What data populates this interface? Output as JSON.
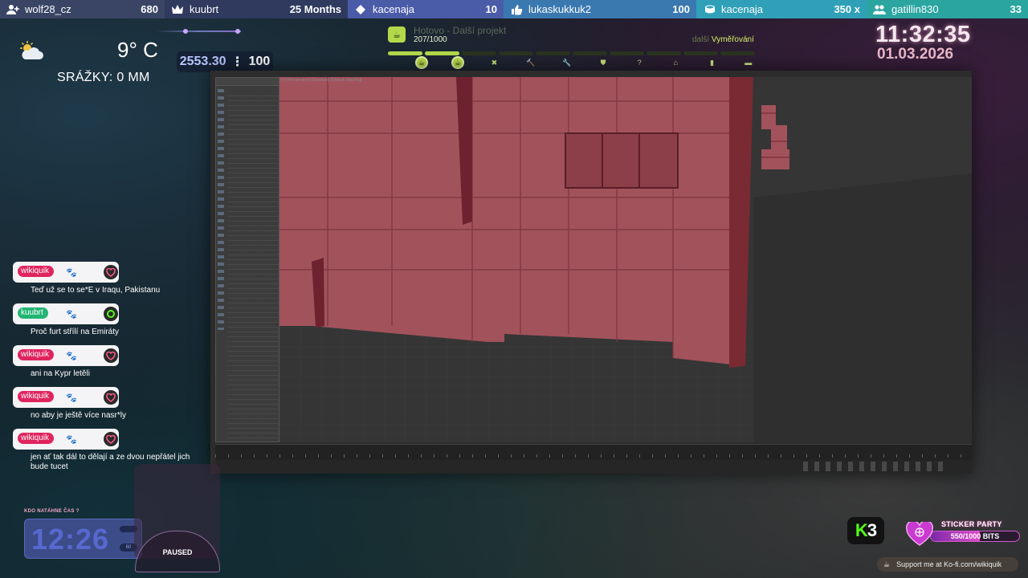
{
  "events": [
    {
      "icon": "user-plus-icon",
      "name": "wolf28_cz",
      "value": "680"
    },
    {
      "icon": "crown-icon",
      "name": "kuubrt",
      "value": "25 Months"
    },
    {
      "icon": "diamond-icon",
      "name": "kacenaja",
      "value": "10"
    },
    {
      "icon": "thumbs-up-icon",
      "name": "lukaskukkuk2",
      "value": "100"
    },
    {
      "icon": "coins-icon",
      "name": "kacenaja",
      "value": "350 x"
    },
    {
      "icon": "users-icon",
      "name": "gatillin830",
      "value": "33"
    }
  ],
  "weather": {
    "temperature": "9° C",
    "precipitation": "SRÁŽKY:  0 MM",
    "icon": "partly-cloudy-icon"
  },
  "goal": {
    "current": "2553.30",
    "target": "100"
  },
  "progress": {
    "title": "Hotovo - Další projekt",
    "count": "207/1000",
    "next_label": "další",
    "next_value": "Vyměřování",
    "fraction": 0.207,
    "milestones": [
      "cup-icon",
      "cup-icon",
      "cross-icon",
      "hammer-icon",
      "wrench-icon",
      "shield-icon",
      "question-icon",
      "home-icon",
      "bookmark-icon",
      "truck-icon"
    ]
  },
  "clock": {
    "time": "11:32:35",
    "date": "01.03.2026"
  },
  "chat": [
    {
      "user": "wikiquik",
      "user_color": "#e0245e",
      "text": "Teď už se to se*E v Iraqu, Pakistanu"
    },
    {
      "user": "kuubrt",
      "user_color": "#22b573",
      "text": "Proč furt střílí na Emiráty"
    },
    {
      "user": "wikiquik",
      "user_color": "#e0245e",
      "text": "ani na Kypr letěli"
    },
    {
      "user": "wikiquik",
      "user_color": "#e0245e",
      "text": "no aby je ještě více nasr*ly"
    },
    {
      "user": "wikiquik",
      "user_color": "#e0245e",
      "text": "jen ať tak dál to dělají a ze dvou nepřátel jich bude tucet"
    }
  ],
  "hold_timer": {
    "title": "KDO NATÁHNE ČAS ?",
    "time": "12:26",
    "badge": "60"
  },
  "media": {
    "state": "PAUSED"
  },
  "kick": {
    "k": "K",
    "num": "3"
  },
  "sticker_party": {
    "title": "STICKER PARTY",
    "count": "550/1000 BITS",
    "fraction": 0.55
  },
  "kofi": {
    "text": "Support me at Ko-fi.com/wikiquik"
  }
}
